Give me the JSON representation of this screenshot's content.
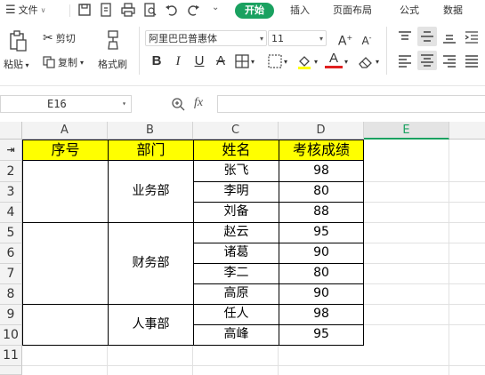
{
  "menu": {
    "file_label": "文件",
    "tabs": [
      "开始",
      "插入",
      "页面布局",
      "公式",
      "数据"
    ]
  },
  "ribbon": {
    "paste_label": "粘贴",
    "cut_label": "剪切",
    "copy_label": "复制",
    "format_painter_label": "格式刷",
    "font_name": "阿里巴巴普惠体",
    "font_size": "11"
  },
  "formula_bar": {
    "name_box": "E16",
    "fx_label": "fx",
    "formula_value": ""
  },
  "sheet": {
    "columns": [
      "A",
      "B",
      "C",
      "D",
      "E"
    ],
    "active_column": "E",
    "rows": [
      "2",
      "3",
      "4",
      "5",
      "6",
      "7",
      "8",
      "9",
      "10",
      "11"
    ],
    "headers": [
      "序号",
      "部门",
      "姓名",
      "考核成绩"
    ],
    "departments": [
      "业务部",
      "财务部",
      "人事部"
    ],
    "names": [
      "张飞",
      "李明",
      "刘备",
      "赵云",
      "诸葛",
      "李二",
      "高原",
      "任人",
      "高峰"
    ],
    "scores": [
      "98",
      "80",
      "88",
      "95",
      "90",
      "80",
      "90",
      "98",
      "95"
    ],
    "header_fill": "#ffff00",
    "accent": "#1aa160"
  }
}
